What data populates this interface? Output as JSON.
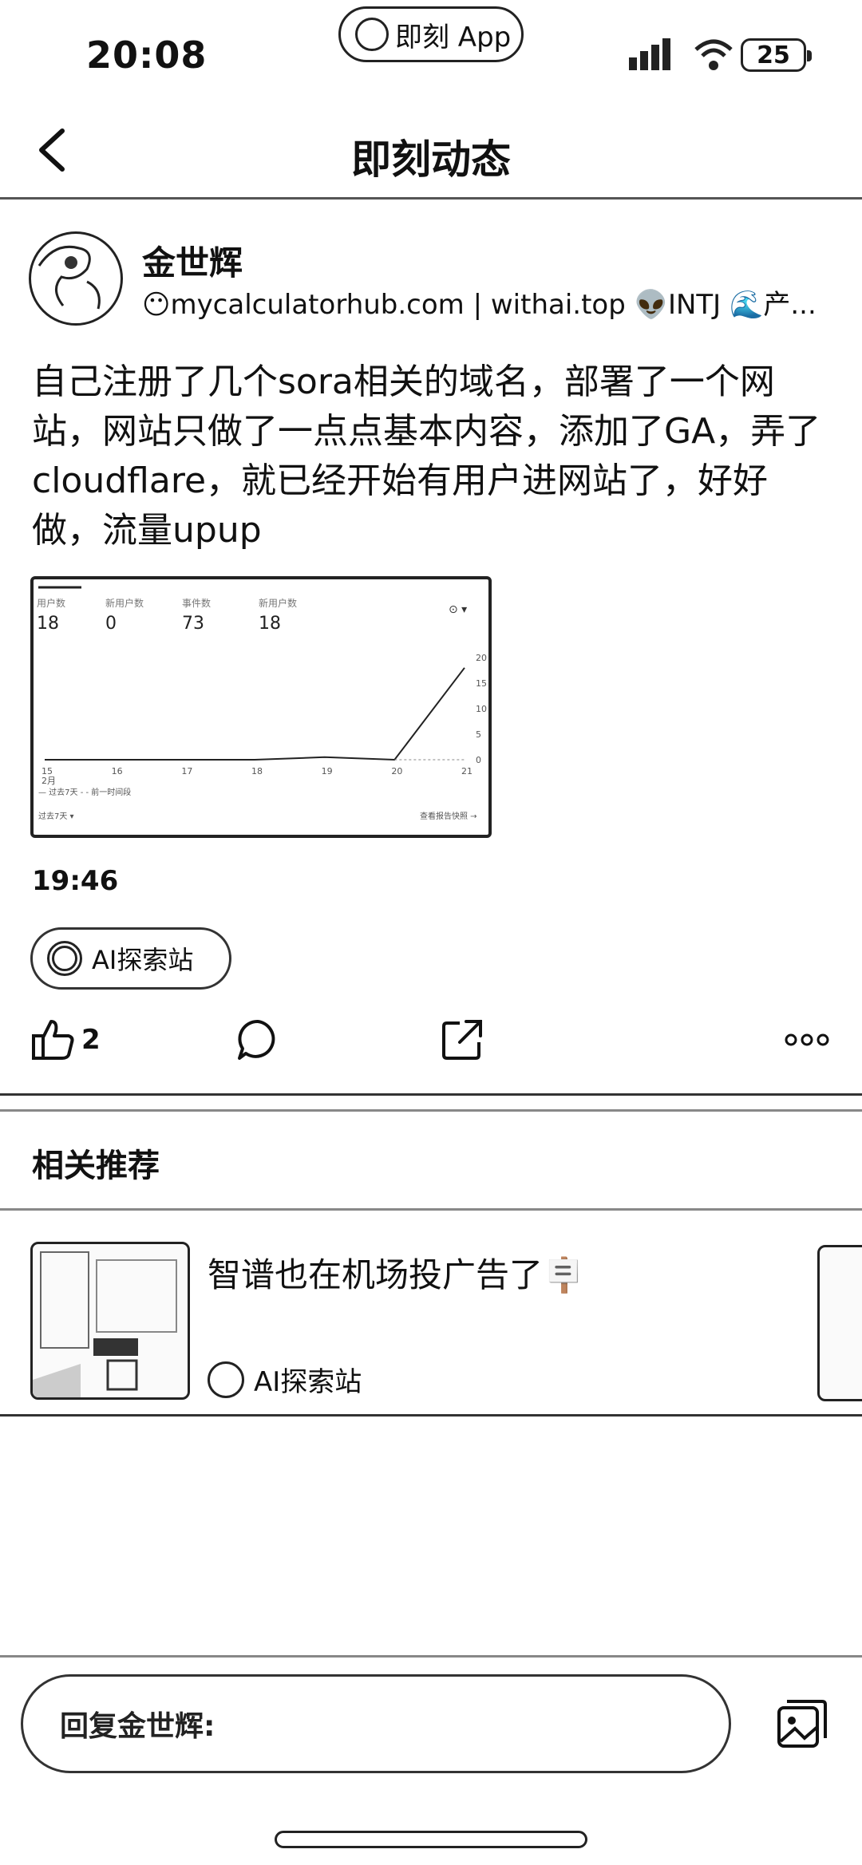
{
  "status_bar": {
    "time": "20:08",
    "app_pill": "即刻 App",
    "battery": "25"
  },
  "nav": {
    "title": "即刻动态",
    "back_icon": "chevron-left-icon"
  },
  "post": {
    "author_name": "金世辉",
    "author_bio": "😶mycalculatorhub.com | withai.top 👽INTJ 🌊产...",
    "content": "自己注册了几个sora相关的域名，部署了一个网站，网站只做了一点点基本内容，添加了GA，弄了cloudflare，就已经开始有用户进网站了，好好做，流量upup",
    "time": "19:46",
    "topic": "AI探索站",
    "like_count": "2",
    "icons": {
      "like": "thumbs-up-icon",
      "comment": "comment-bubble-icon",
      "share": "share-icon",
      "more": "more-dots-icon"
    }
  },
  "chart_data": {
    "type": "line",
    "stats": [
      {
        "label": "用户数",
        "value": "18"
      },
      {
        "label": "新用户数",
        "value": "0"
      },
      {
        "label": "事件数",
        "value": "73"
      },
      {
        "label": "新用户数",
        "value": "18"
      }
    ],
    "x": [
      "15",
      "16",
      "17",
      "18",
      "19",
      "20",
      "21"
    ],
    "series": [
      {
        "name": "过去7天",
        "values": [
          0,
          0,
          0,
          0,
          0.5,
          0,
          18
        ]
      }
    ],
    "ylim": [
      0,
      20
    ],
    "yticks": [
      "20",
      "15",
      "10",
      "5",
      "0"
    ],
    "x_first_sub": "2月",
    "legend": "— 过去7天  - - 前一时间段",
    "footer_left": "过去7天 ▾",
    "footer_right": "查看报告快照 →"
  },
  "related": {
    "heading": "相关推荐",
    "items": [
      {
        "title": "智谱也在机场投广告了🪧",
        "topic": "AI探索站"
      }
    ]
  },
  "reply": {
    "placeholder": "回复金世辉:",
    "image_icon": "image-picker-icon"
  }
}
